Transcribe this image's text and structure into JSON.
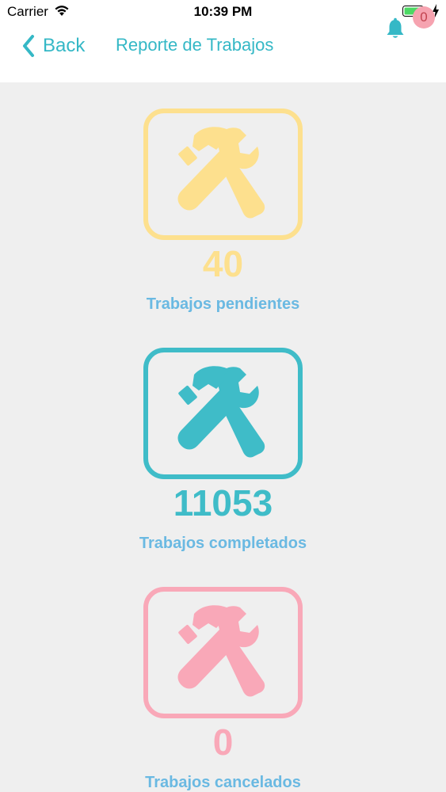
{
  "status_bar": {
    "carrier": "Carrier",
    "time": "10:39 PM"
  },
  "nav": {
    "back_label": "Back",
    "title": "Reporte de Trabajos",
    "notification_count": "0"
  },
  "colors": {
    "accent": "#35b8c6",
    "label": "#6ab9e2",
    "pending": "#fde08e",
    "completed": "#3fbcc8",
    "cancelled": "#f9a8b8"
  },
  "cards": [
    {
      "count": "40",
      "label": "Trabajos pendientes",
      "icon": "tools-icon"
    },
    {
      "count": "11053",
      "label": "Trabajos completados",
      "icon": "tools-icon"
    },
    {
      "count": "0",
      "label": "Trabajos cancelados",
      "icon": "tools-icon"
    }
  ]
}
